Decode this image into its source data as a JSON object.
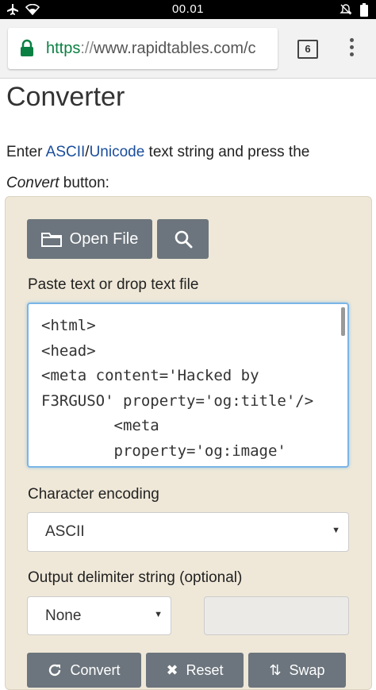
{
  "status_bar": {
    "time": "00.01",
    "icons": [
      "airplane-icon",
      "wifi-icon",
      "mute-icon",
      "battery-icon"
    ]
  },
  "browser": {
    "url_scheme": "https",
    "url_sep": "://",
    "url_rest": "www.rapidtables.com/c",
    "tab_count": "6"
  },
  "page": {
    "title": "Converter",
    "intro_pre": "Enter ",
    "link_ascii": "ASCII",
    "slash": "/",
    "link_unicode": "Unicode",
    "intro_mid": " text string and press the ",
    "intro_em": "Convert",
    "intro_post": " button:"
  },
  "panel": {
    "open_file_label": "Open File",
    "paste_label": "Paste text or drop text file",
    "textarea_value": "<html>\n<head>\n<meta content='Hacked by F3RGUSO' property='og:title'/>\n        <meta\n        property='og:image'",
    "encoding_label": "Character encoding",
    "encoding_value": "ASCII",
    "delimiter_label": "Output delimiter string (optional)",
    "delimiter_value": "None",
    "delimiter_custom": "",
    "convert_label": "Convert",
    "reset_label": "Reset",
    "swap_label": "Swap"
  },
  "colors": {
    "panel_bg": "#efe8d8",
    "button_bg": "#6c757d",
    "link": "#1a4d9c",
    "lock_green": "#0b8043",
    "focus_border": "#7ab5e6"
  }
}
